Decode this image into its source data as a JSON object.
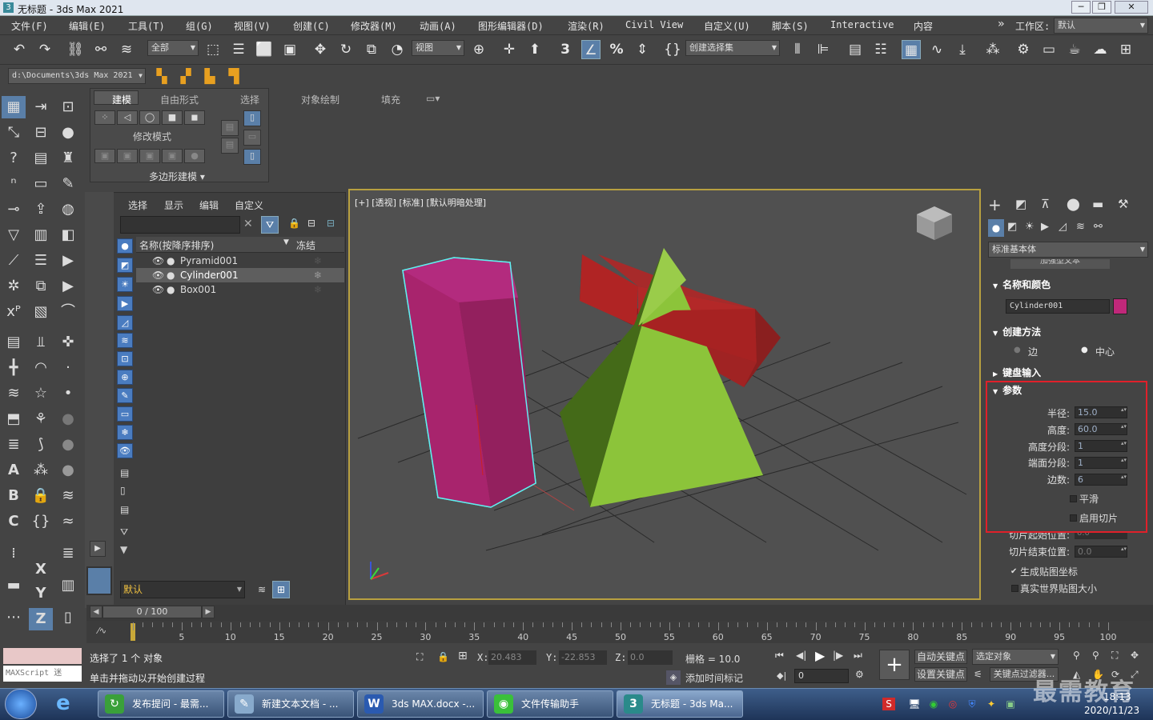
{
  "window": {
    "title": "无标题 - 3ds Max 2021",
    "min": "─",
    "max": "❐",
    "close": "✕"
  },
  "menu": [
    "文件(F)",
    "编辑(E)",
    "工具(T)",
    "组(G)",
    "视图(V)",
    "创建(C)",
    "修改器(M)",
    "动画(A)",
    "图形编辑器(D)",
    "渲染(R)",
    "Civil View",
    "自定义(U)",
    "脚本(S)",
    "Interactive",
    "内容"
  ],
  "workspace": {
    "label": "工作区:",
    "value": "默认",
    "chevron": "»"
  },
  "toolbar": {
    "filter": "全部",
    "refcoord": "视图",
    "selset": "创建选择集",
    "snap_label": "3",
    "angle_label": "%"
  },
  "project_path": "d:\\Documents\\3ds Max 2021",
  "ribbon": {
    "tabs": [
      "建模",
      "自由形式",
      "选择",
      "对象绘制",
      "填充"
    ],
    "modify_mode": "修改模式",
    "poly_modeling": "多边形建模 ▾"
  },
  "scene_explorer": {
    "menu": [
      "选择",
      "显示",
      "编辑",
      "自定义"
    ],
    "col_name": "名称(按降序排序)",
    "col_freeze": "冻结",
    "rows": [
      {
        "name": "Pyramid001",
        "selected": false
      },
      {
        "name": "Cylinder001",
        "selected": true
      },
      {
        "name": "Box001",
        "selected": false
      }
    ],
    "layer": "默认"
  },
  "viewport": {
    "label": "[+] [透视] [标准] [默认明暗处理]"
  },
  "command_panel": {
    "category": "标准基本体",
    "partial": "加强型文本",
    "rollouts": {
      "name_color": "名称和颜色",
      "object_name": "Cylinder001",
      "object_color": "#c0287a",
      "creation": "创建方法",
      "creation_opts": [
        "边",
        "中心"
      ],
      "keyboard": "键盘输入",
      "params": "参数"
    },
    "params": [
      {
        "label": "半径:",
        "value": "15.0"
      },
      {
        "label": "高度:",
        "value": "60.0"
      },
      {
        "label": "高度分段:",
        "value": "1"
      },
      {
        "label": "端面分段:",
        "value": "1"
      },
      {
        "label": "边数:",
        "value": "6"
      }
    ],
    "smooth": "平滑",
    "slice_on": "启用切片",
    "slice_from": {
      "label": "切片起始位置:",
      "value": "0.0"
    },
    "slice_to": {
      "label": "切片结束位置:",
      "value": "0.0"
    },
    "gen_map": "生成贴图坐标",
    "real_world": "真实世界贴图大小"
  },
  "timeline": {
    "frame": "0 / 100",
    "ticks": [
      "0",
      "5",
      "10",
      "15",
      "20",
      "25",
      "30",
      "35",
      "40",
      "45",
      "50",
      "55",
      "60",
      "65",
      "70",
      "75",
      "80",
      "85",
      "90",
      "95",
      "100"
    ]
  },
  "status": {
    "maxscript": "MAXScript 迷",
    "selected": "选择了 1 个 对象",
    "prompt": "单击并拖动以开始创建过程",
    "x_label": "X:",
    "x": "20.483",
    "y_label": "Y:",
    "y": "-22.853",
    "z_label": "Z:",
    "z": "0.0",
    "grid": "栅格 = 10.0",
    "add_tag": "添加时间标记",
    "autokey": "自动关键点",
    "setkey": "设置关键点",
    "selected_obj": "选定对象",
    "key_filter": "关键点过滤器...",
    "frame_spin": "0"
  },
  "taskbar": {
    "tasks": [
      "发布提问 - 最需...",
      "新建文本文档 - ...",
      "3ds MAX.docx -...",
      "文件传输助手",
      "无标题 - 3ds Ma..."
    ],
    "time": "18:13",
    "date": "2020/11/23",
    "watermark": "最需教育"
  },
  "colors": {
    "highlight_box": "#e0202a",
    "viewport_border": "#b8a040",
    "cyl": "#b02a78",
    "pyr": "#8cc43a",
    "box": "#b82828"
  }
}
